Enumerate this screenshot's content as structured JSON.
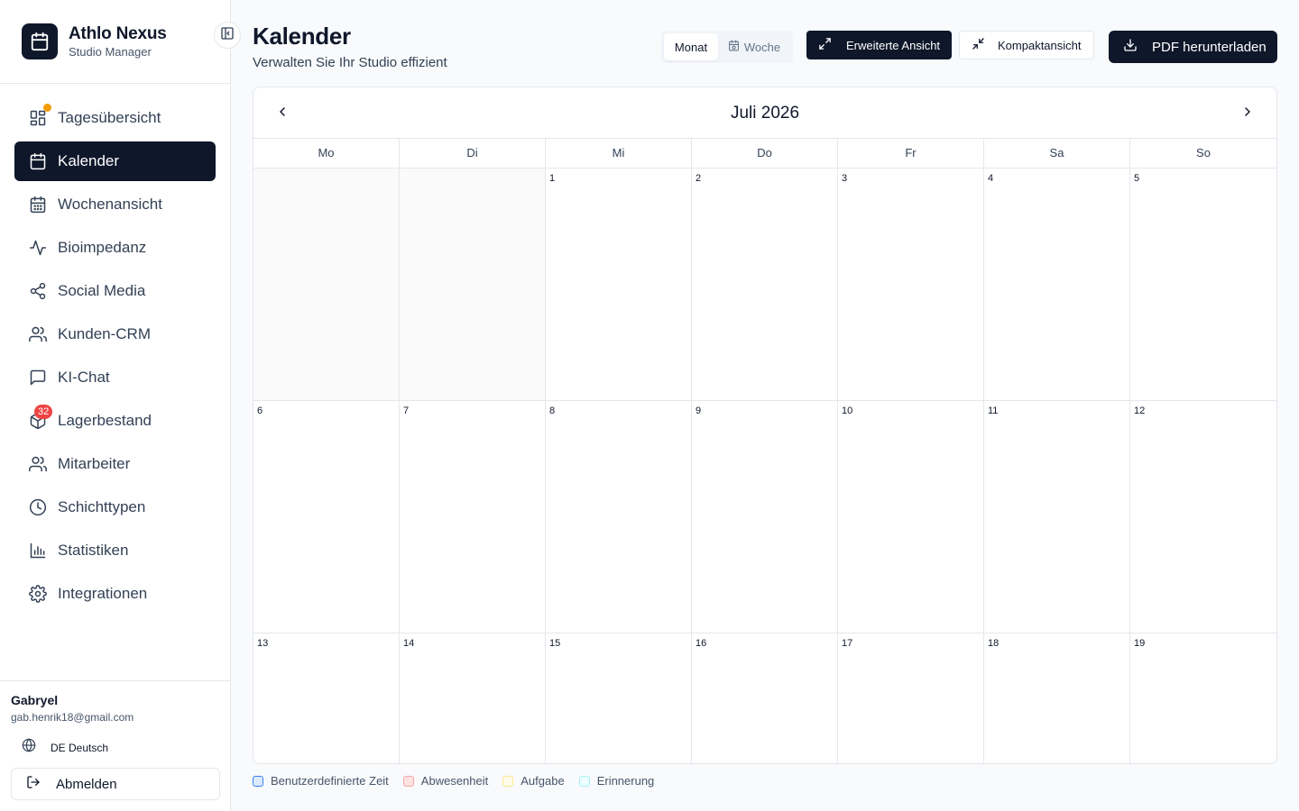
{
  "brand": {
    "name": "Athlo Nexus",
    "subtitle": "Studio Manager"
  },
  "sidebar": {
    "items": [
      {
        "label": "Tagesübersicht",
        "icon": "dashboard-icon"
      },
      {
        "label": "Kalender",
        "icon": "calendar-icon",
        "active": true
      },
      {
        "label": "Wochenansicht",
        "icon": "calendar-week-icon"
      },
      {
        "label": "Bioimpedanz",
        "icon": "activity-icon"
      },
      {
        "label": "Social Media",
        "icon": "share-icon"
      },
      {
        "label": "Kunden-CRM",
        "icon": "users-icon"
      },
      {
        "label": "KI-Chat",
        "icon": "chat-icon"
      },
      {
        "label": "Lagerbestand",
        "icon": "package-icon",
        "badge": "32"
      },
      {
        "label": "Mitarbeiter",
        "icon": "user-group-icon"
      },
      {
        "label": "Schichttypen",
        "icon": "clock-icon"
      },
      {
        "label": "Statistiken",
        "icon": "bar-chart-icon"
      },
      {
        "label": "Integrationen",
        "icon": "gear-icon"
      }
    ]
  },
  "user": {
    "name": "Gabryel",
    "email": "gab.henrik18@gmail.com"
  },
  "language": {
    "label": "DE Deutsch"
  },
  "logout": {
    "label": "Abmelden"
  },
  "header": {
    "title": "Kalender",
    "subtitle": "Verwalten Sie Ihr Studio effizient"
  },
  "view_toggle": {
    "month": "Monat",
    "week": "Woche"
  },
  "buttons": {
    "extended": "Erweiterte Ansicht",
    "compact": "Kompaktansicht",
    "pdf": "PDF herunterladen"
  },
  "calendar": {
    "month_title": "Juli 2026",
    "weekdays": [
      "Mo",
      "Di",
      "Mi",
      "Do",
      "Fr",
      "Sa",
      "So"
    ],
    "days": [
      "",
      "",
      "1",
      "2",
      "3",
      "4",
      "5",
      "6",
      "7",
      "8",
      "9",
      "10",
      "11",
      "12",
      "13",
      "14",
      "15",
      "16",
      "17",
      "18",
      "19"
    ]
  },
  "legend": [
    {
      "label": "Benutzerdefinierte Zeit",
      "border": "#3b82f6",
      "fill": "#dbeafe"
    },
    {
      "label": "Abwesenheit",
      "border": "#fca5a5",
      "fill": "#fee2e2"
    },
    {
      "label": "Aufgabe",
      "border": "#fde68a",
      "fill": "#fefce8"
    },
    {
      "label": "Erinnerung",
      "border": "#a5f3fc",
      "fill": "#ecfeff"
    }
  ],
  "colors": {
    "primary": "#0f172a",
    "badge_dot": "#f59e0b",
    "badge_count": "#ef4444"
  }
}
